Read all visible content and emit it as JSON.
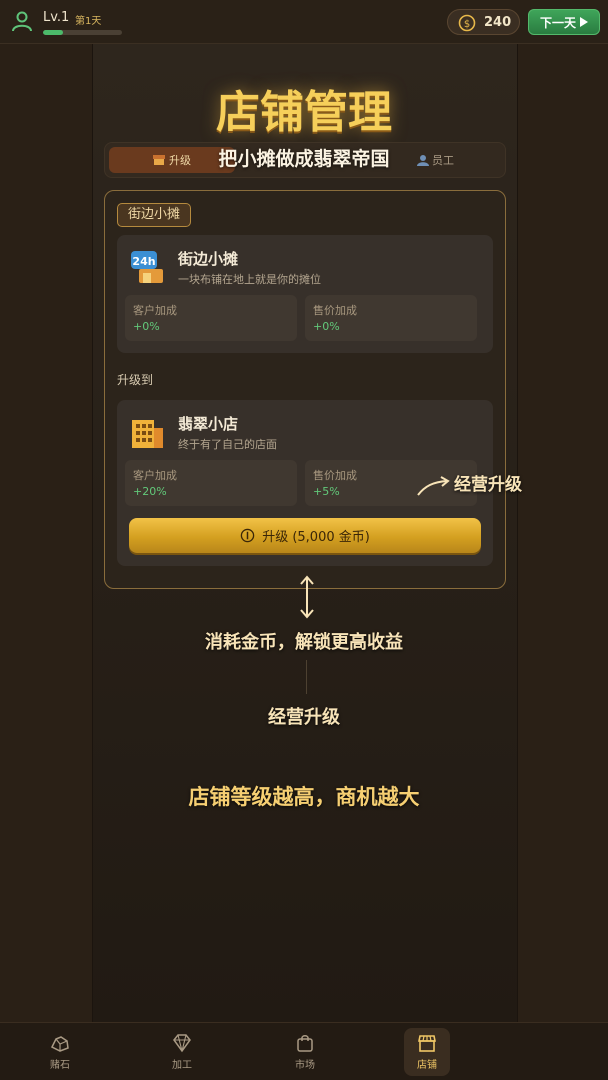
{
  "topbar": {
    "level": "Lv.1",
    "day": "第1天",
    "xp_progress": 0.25,
    "coins": "240",
    "next_day_label": "下一天"
  },
  "page": {
    "title": "店铺管理",
    "subtitle": "把小摊做成翡翠帝国",
    "tabs": [
      {
        "label": "升级",
        "icon": "shop-icon",
        "active": true
      },
      {
        "label": "员工",
        "icon": "staff-icon",
        "active": false
      }
    ]
  },
  "card": {
    "badge": "街边小摊",
    "current": {
      "name": "街边小摊",
      "desc": "一块布铺在地上就是你的摊位",
      "stats": [
        {
          "label": "客户加成",
          "value": "+0%"
        },
        {
          "label": "售价加成",
          "value": "+0%"
        }
      ]
    },
    "upgrade_to_label": "升级到",
    "next": {
      "name": "翡翠小店",
      "desc": "终于有了自己的店面",
      "stats": [
        {
          "label": "客户加成",
          "value": "+20%"
        },
        {
          "label": "售价加成",
          "value": "+5%"
        }
      ]
    },
    "upgrade_button": "升级 (5,000 金币)"
  },
  "annotations": {
    "right_label": "经营升级",
    "consume": "消耗金币，解锁更高收益",
    "business": "经营升级",
    "level": "店铺等级越高，商机越大"
  },
  "bottomnav": [
    {
      "label": "赌石",
      "icon": "gamble-stone-icon",
      "active": false
    },
    {
      "label": "加工",
      "icon": "diamond-icon",
      "active": false
    },
    {
      "label": "市场",
      "icon": "shopping-bag-icon",
      "active": false
    },
    {
      "label": "店铺",
      "icon": "store-icon",
      "active": true
    }
  ],
  "colors": {
    "accent_gold": "#f6cf5a",
    "positive_green": "#62c97a",
    "next_button_green": "#3fa55a"
  }
}
